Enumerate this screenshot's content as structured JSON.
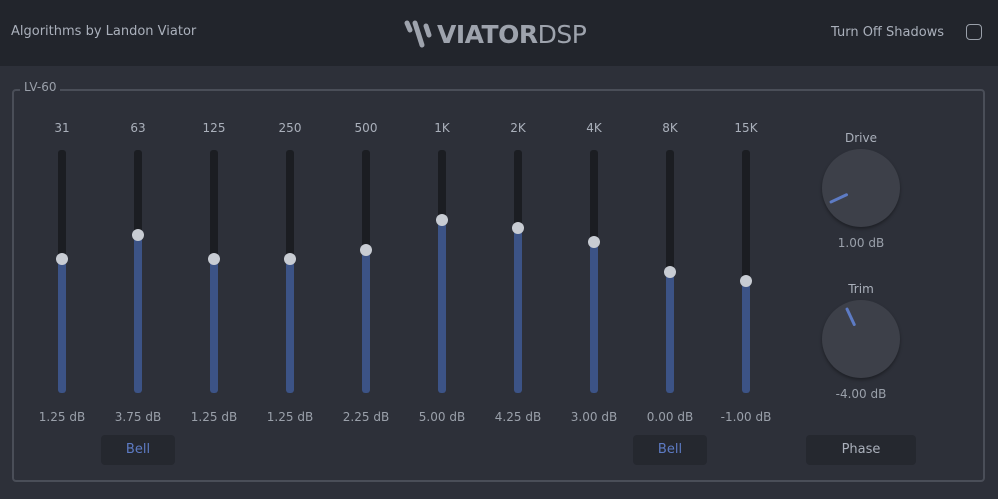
{
  "header": {
    "credit": "Algorithms by Landon Viator",
    "logo_bold": "VIATOR",
    "logo_light": "DSP",
    "shadow_label": "Turn Off Shadows",
    "shadow_checked": false
  },
  "group": {
    "title": "LV-60"
  },
  "bands": [
    {
      "freq": "31",
      "gain": "1.25 dB",
      "level": 0.55
    },
    {
      "freq": "63",
      "gain": "3.75 dB",
      "level": 0.65
    },
    {
      "freq": "125",
      "gain": "1.25 dB",
      "level": 0.55
    },
    {
      "freq": "250",
      "gain": "1.25 dB",
      "level": 0.55
    },
    {
      "freq": "500",
      "gain": "2.25 dB",
      "level": 0.59
    },
    {
      "freq": "1K",
      "gain": "5.00 dB",
      "level": 0.71
    },
    {
      "freq": "2K",
      "gain": "4.25 dB",
      "level": 0.68
    },
    {
      "freq": "4K",
      "gain": "3.00 dB",
      "level": 0.62
    },
    {
      "freq": "8K",
      "gain": "0.00 dB",
      "level": 0.5
    },
    {
      "freq": "15K",
      "gain": "-1.00 dB",
      "level": 0.46
    }
  ],
  "buttons": {
    "bell_low": "Bell",
    "bell_high": "Bell",
    "phase": "Phase"
  },
  "drive": {
    "label": "Drive",
    "value": "1.00 dB",
    "angle": -115
  },
  "trim": {
    "label": "Trim",
    "value": "-4.00 dB",
    "angle": -25
  },
  "colors": {
    "accent": "#5d7bc4",
    "fill": "#3c5386",
    "background": "#2d3039",
    "header": "#22252c"
  }
}
